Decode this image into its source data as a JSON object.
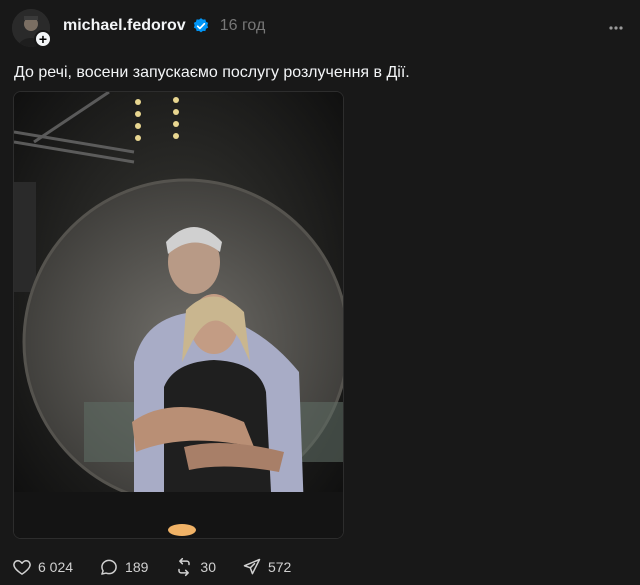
{
  "post": {
    "username": "michael.fedorov",
    "timestamp": "16 год",
    "caption": "До речі, восени запускаємо послугу розлучення в Дії.",
    "stats": {
      "likes": "6 024",
      "replies": "189",
      "reposts": "30",
      "shares": "572"
    }
  },
  "icons": {
    "verified": "verified-badge-icon",
    "more": "more-horizontal-icon",
    "like": "heart-icon",
    "reply": "comment-icon",
    "repost": "repost-icon",
    "share": "send-icon",
    "follow": "plus-icon"
  },
  "colors": {
    "background": "#181818",
    "text": "#f3f5f7",
    "muted": "#777777",
    "verified": "#0095f6"
  }
}
